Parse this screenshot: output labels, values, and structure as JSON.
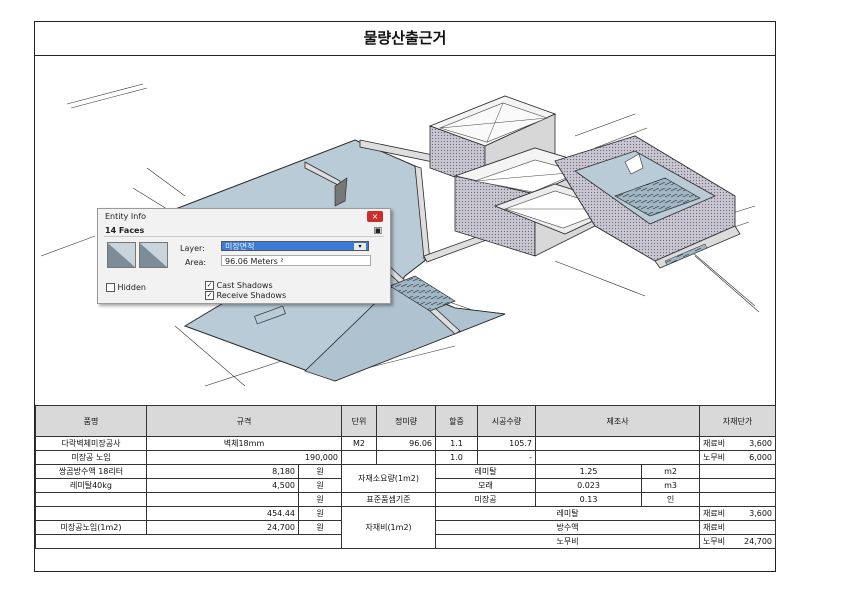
{
  "title": "물량산출근거",
  "entity_info": {
    "window_title": "Entity Info",
    "close_glyph": "×",
    "faces": "14 Faces",
    "layer_label": "Layer:",
    "layer_value": "미장면적",
    "area_label": "Area:",
    "area_value": "96.06 Meters ²",
    "hidden_label": "Hidden",
    "hidden_checked": false,
    "cast_shadows_label": "Cast Shadows",
    "cast_shadows_checked": true,
    "receive_shadows_label": "Receive Shadows",
    "receive_shadows_checked": true,
    "check_glyph": "✓",
    "dropdown_glyph": "▾",
    "pin_glyph": "▣",
    "icons": [
      "close-icon",
      "pin-icon",
      "dropdown-icon",
      "material-swatch-icon"
    ]
  },
  "table": {
    "headers": {
      "item": "품명",
      "spec": "규격",
      "unit": "단위",
      "net_qty": "정미량",
      "surcharge": "할증",
      "work_qty": "시공수량",
      "maker": "제조사",
      "material_unit_price": "자재단가"
    },
    "rows": {
      "r1": {
        "item": "다락벽체미장공사",
        "spec": "벽체18mm",
        "unit": "M2",
        "net_qty": "96.06",
        "surcharge": "1.1",
        "work_qty": "105.7",
        "cost_type": "재료비",
        "price": "3,600"
      },
      "r2": {
        "item": "미장공 노임",
        "spec_value": "190,000",
        "surcharge": "1.0",
        "work_qty": "-",
        "cost_type": "노무비",
        "price": "6,000"
      },
      "r3": {
        "item": "쌍곰방수액 18리터",
        "value": "8,180",
        "won": "원",
        "group": "자재소요량(1m2)",
        "material": "레미탈",
        "qty": "1.25",
        "unit": "m2"
      },
      "r4": {
        "item": "레미탈40kg",
        "value": "4,500",
        "won": "원",
        "material": "모래",
        "qty": "0.023",
        "unit": "m3"
      },
      "r5": {
        "won": "원",
        "group": "표준품셈기준",
        "material": "미장공",
        "qty": "0.13",
        "unit": "인"
      },
      "r6": {
        "value": "454.44",
        "won": "원",
        "group": "자재비(1m2)",
        "material": "레미탈",
        "cost_type": "재료비",
        "price": "3,600"
      },
      "r7": {
        "item": "미장공노임(1m2)",
        "value": "24,700",
        "won": "원",
        "material": "방수액",
        "cost_type": "재료비"
      },
      "r8": {
        "material": "노무비",
        "cost_type": "노무비",
        "price": "24,700"
      }
    }
  },
  "colors": {
    "face_fill": "#b9cbd6",
    "wall_fill": "#dcdcdc",
    "stipple": "#8a8a96",
    "layer_highlight": "#3a7bd5",
    "header_bg": "#d9d9d9"
  }
}
